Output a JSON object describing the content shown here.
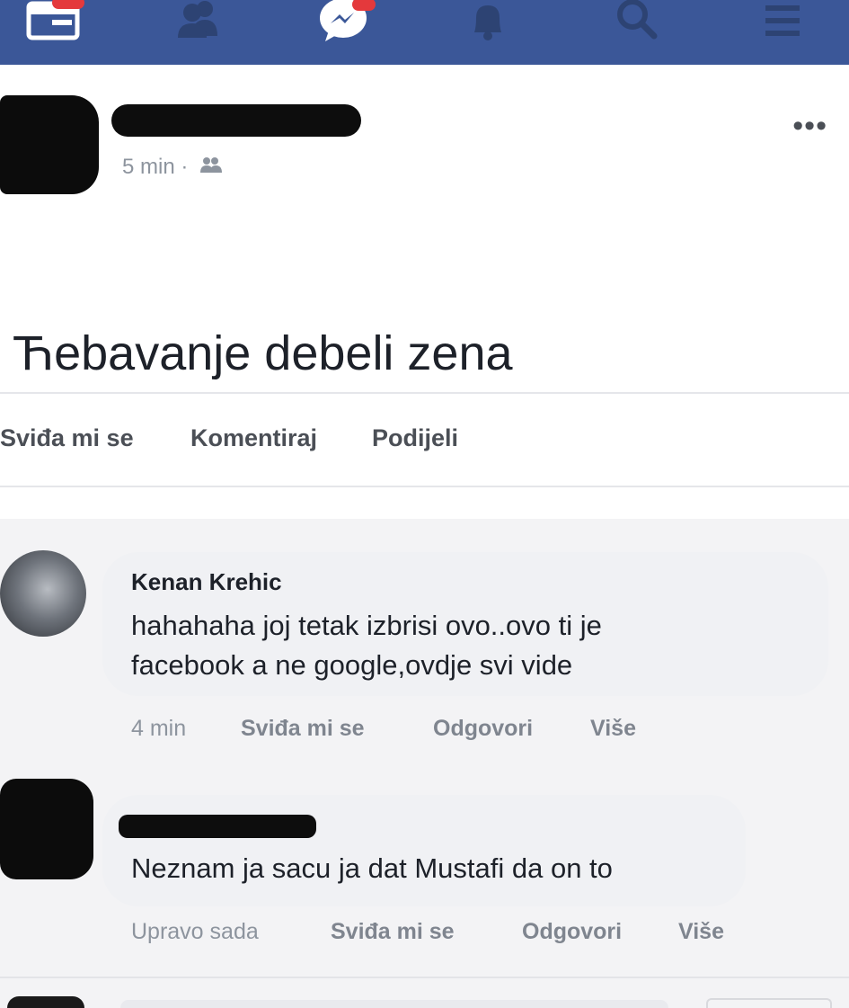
{
  "navbar": {
    "icons": [
      "feed-icon",
      "friends-icon",
      "messenger-icon",
      "notifications-icon",
      "search-icon",
      "menu-icon"
    ],
    "background": "#3b5798"
  },
  "post": {
    "time": "5 min",
    "separator": "·",
    "text": "Ћebavanje debeli zena",
    "actions": {
      "like": "Sviđa mi se",
      "comment": "Komentiraj",
      "share": "Podijeli"
    }
  },
  "comments": [
    {
      "author": "Kenan Krehic",
      "text_line1": "hahahaha joj tetak izbrisi ovo..ovo ti je",
      "text_line2": "facebook a ne google,ovdje svi vide",
      "time": "4 min",
      "like": "Sviđa mi se",
      "reply": "Odgovori",
      "more": "Više"
    },
    {
      "text": "Neznam ja sacu ja dat Mustafi da on to",
      "time": "Upravo sada",
      "like": "Sviđa mi se",
      "reply": "Odgovori",
      "more": "Više"
    }
  ]
}
